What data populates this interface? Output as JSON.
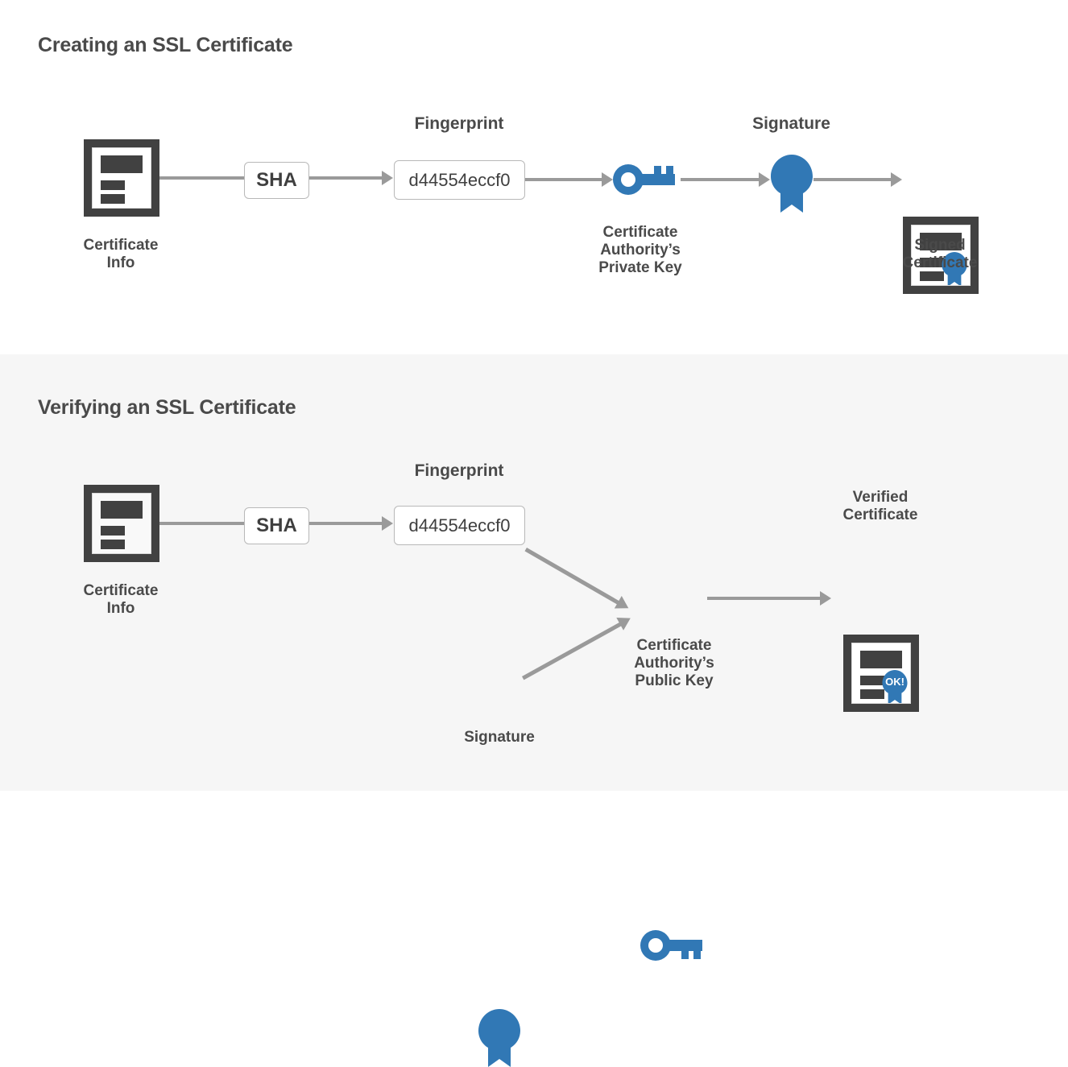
{
  "colors": {
    "accent_blue": "#3178b5",
    "dark_gray": "#414141",
    "text_gray": "#4a4a4a",
    "connector_gray": "#9a9a9a",
    "section_bg_light": "#f6f6f6",
    "page_bg": "#ffffff"
  },
  "sections": [
    {
      "id": "create",
      "title": "Creating an SSL Certificate",
      "nodes": {
        "cert_info_label": "Certificate\nInfo",
        "sha_label": "SHA",
        "fingerprint_title": "Fingerprint",
        "fingerprint_value": "d44554eccf0",
        "private_key_label": "Certificate\nAuthority’s\nPrivate Key",
        "signature_label": "Signature",
        "signed_cert_label": "Signed\nCertificate"
      }
    },
    {
      "id": "verify",
      "title": "Verifying an SSL Certificate",
      "nodes": {
        "cert_info_label": "Certificate\nInfo",
        "sha_label": "SHA",
        "fingerprint_title": "Fingerprint",
        "fingerprint_value": "d44554eccf0",
        "public_key_label": "Certificate\nAuthority’s\nPublic Key",
        "signature_label": "Signature",
        "verified_cert_label": "Verified\nCertificate",
        "verified_badge_text": "OK!"
      }
    }
  ]
}
